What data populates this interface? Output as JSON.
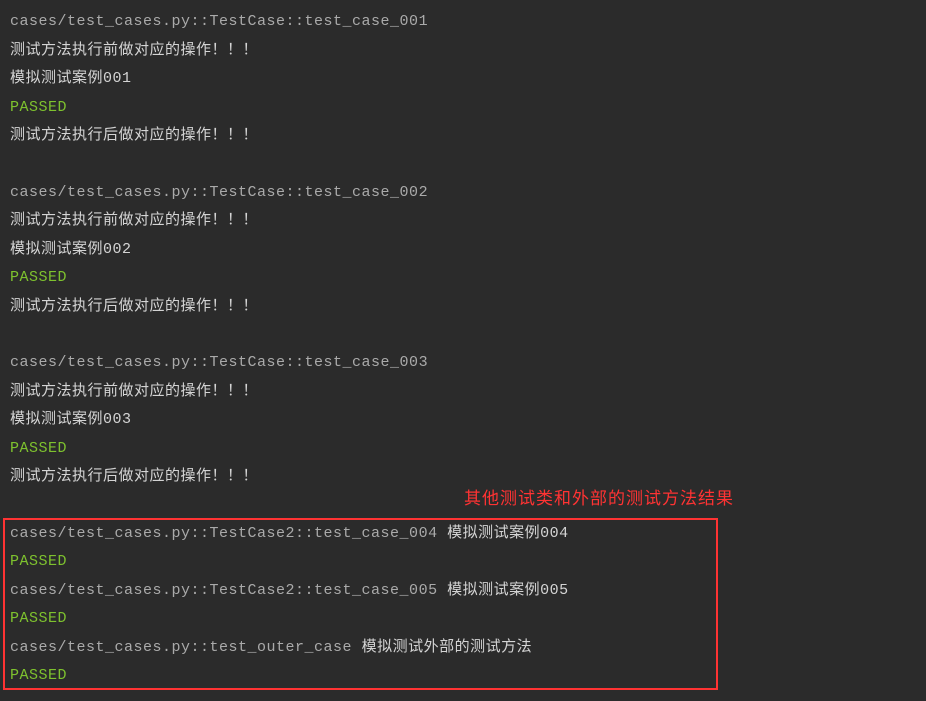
{
  "tests": [
    {
      "path": "cases/test_cases.py::TestCase::test_case_001",
      "before": "测试方法执行前做对应的操作！！！",
      "simulate": "模拟测试案例001",
      "status": "PASSED",
      "after": "测试方法执行后做对应的操作！！！"
    },
    {
      "path": "cases/test_cases.py::TestCase::test_case_002",
      "before": "测试方法执行前做对应的操作！！！",
      "simulate": "模拟测试案例002",
      "status": "PASSED",
      "after": "测试方法执行后做对应的操作！！！"
    },
    {
      "path": "cases/test_cases.py::TestCase::test_case_003",
      "before": "测试方法执行前做对应的操作！！！",
      "simulate": "模拟测试案例003",
      "status": "PASSED",
      "after": "测试方法执行后做对应的操作！！！"
    }
  ],
  "other_tests": [
    {
      "path": "cases/test_cases.py::TestCase2::test_case_004 ",
      "simulate": "模拟测试案例004",
      "status": "PASSED"
    },
    {
      "path": "cases/test_cases.py::TestCase2::test_case_005 ",
      "simulate": "模拟测试案例005",
      "status": "PASSED"
    },
    {
      "path": "cases/test_cases.py::test_outer_case ",
      "simulate": "模拟测试外部的测试方法",
      "status": "PASSED"
    }
  ],
  "annotation_text": "其他测试类和外部的测试方法结果"
}
